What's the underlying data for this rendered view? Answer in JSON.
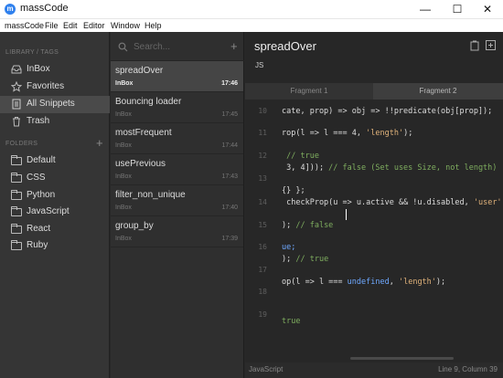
{
  "app": {
    "title": "massCode",
    "icon_glyph": "m"
  },
  "window_controls": {
    "minimize": "—",
    "maximize": "☐",
    "close": "✕"
  },
  "menu": [
    "massCode",
    "File",
    "Edit",
    "Editor",
    "Window",
    "Help"
  ],
  "sidebar": {
    "library_label": "LIBRARY / TAGS",
    "library": [
      {
        "label": "InBox",
        "icon": "inbox-icon"
      },
      {
        "label": "Favorites",
        "icon": "star-icon"
      },
      {
        "label": "All Snippets",
        "icon": "stack-icon",
        "selected": true
      },
      {
        "label": "Trash",
        "icon": "trash-icon"
      }
    ],
    "folders_label": "FOLDERS",
    "folders": [
      "Default",
      "CSS",
      "Python",
      "JavaScript",
      "React",
      "Ruby"
    ]
  },
  "snippet_list": {
    "search_placeholder": "Search...",
    "items": [
      {
        "name": "spreadOver",
        "folder": "InBox",
        "date": "17:46",
        "selected": true
      },
      {
        "name": "Bouncing loader",
        "folder": "InBox",
        "date": "17:45"
      },
      {
        "name": "mostFrequent",
        "folder": "InBox",
        "date": "17:44"
      },
      {
        "name": "usePrevious",
        "folder": "InBox",
        "date": "17:43"
      },
      {
        "name": "filter_non_unique",
        "folder": "InBox",
        "date": "17:40"
      },
      {
        "name": "group_by",
        "folder": "InBox",
        "date": "17:39"
      }
    ]
  },
  "editor": {
    "title": "spreadOver",
    "language_tag": "JS",
    "tabs": [
      "Fragment 1",
      "Fragment 2"
    ],
    "line_numbers": [
      "10",
      "11",
      "12",
      "13",
      "14",
      "15",
      "16",
      "17",
      "18",
      "19"
    ],
    "code_lines": [
      [
        {
          "t": "cate, prop) => obj => !!predicate(obj[prop]);",
          "c": ""
        }
      ],
      [
        {
          "t": "rop(l => l === 4, ",
          "c": ""
        },
        {
          "t": "'length'",
          "c": "st"
        },
        {
          "t": ");",
          "c": ""
        }
      ],
      [
        {
          "t": " // true",
          "c": "cm"
        }
      ],
      [
        {
          "t": " 3, 4]));",
          "c": ""
        },
        {
          "t": " // false (Set uses Size, not length)",
          "c": "cm"
        }
      ],
      [
        {
          "t": "{} };",
          "c": ""
        }
      ],
      [
        {
          "t": " checkProp(u ",
          "c": ""
        },
        {
          "t": "=>",
          "c": ""
        },
        {
          "t": " u.active && !u.disabled, ",
          "c": ""
        },
        {
          "t": "'user'",
          "c": "st"
        }
      ],
      [
        {
          "t": "); ",
          "c": ""
        },
        {
          "t": "// false",
          "c": "cm"
        }
      ],
      [
        {
          "t": "ue;",
          "c": "kw"
        }
      ],
      [
        {
          "t": "); ",
          "c": ""
        },
        {
          "t": "// true",
          "c": "cm"
        }
      ],
      [
        {
          "t": "op(l => l === ",
          "c": ""
        },
        {
          "t": "undefined",
          "c": "kw"
        },
        {
          "t": ", ",
          "c": ""
        },
        {
          "t": "'length'",
          "c": "st"
        },
        {
          "t": ");",
          "c": ""
        }
      ],
      [
        {
          "t": "",
          "c": ""
        }
      ],
      [
        {
          "t": "true",
          "c": "cm"
        }
      ]
    ],
    "status_language": "JavaScript",
    "status_position": "Line 9, Column 39"
  },
  "colors": {
    "accent": "#2f80ed",
    "string": "#e0b27a",
    "keyword": "#6ea8ff",
    "comment": "#7fae5f"
  }
}
